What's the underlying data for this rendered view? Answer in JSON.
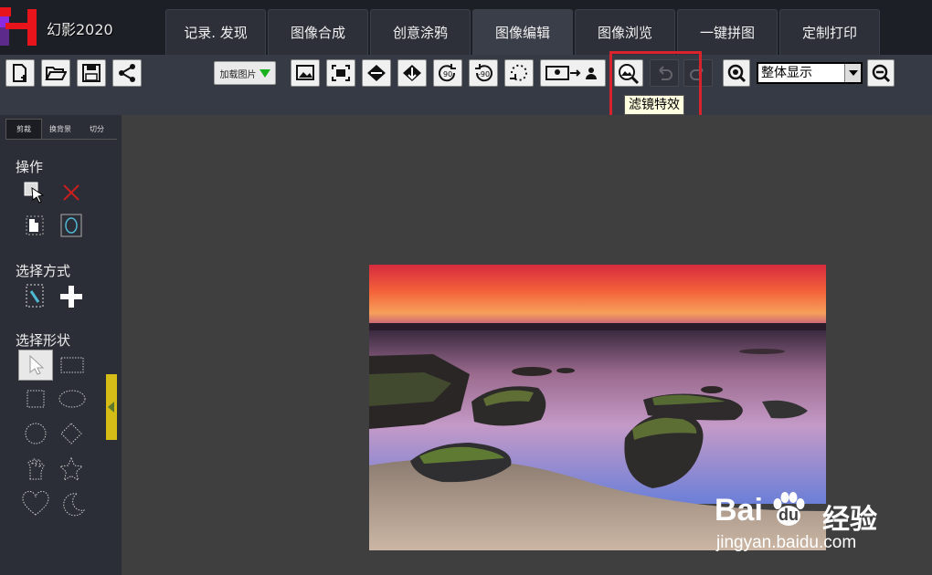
{
  "app": {
    "title": "幻影2020"
  },
  "tabs": [
    {
      "label": "记录. 发现"
    },
    {
      "label": "图像合成"
    },
    {
      "label": "创意涂鸦"
    },
    {
      "label": "图像编辑",
      "active": true
    },
    {
      "label": "图像浏览"
    },
    {
      "label": "一键拼图"
    },
    {
      "label": "定制打印"
    }
  ],
  "toolbar": {
    "load_label": "加载图片",
    "zoom": {
      "value": "整体显示"
    },
    "tooltip": "滤镜特效"
  },
  "left_panel": {
    "sub_tabs": [
      "剪裁",
      "换背景",
      "切分"
    ],
    "sections": {
      "operation": "操作",
      "select_mode": "选择方式",
      "select_shape": "选择形状"
    }
  },
  "watermark": {
    "brand": "Bai",
    "brand2": "du",
    "cn": "经验",
    "url": "jingyan.baidu.com"
  },
  "colors": {
    "accent_red": "#d8222c",
    "toolbar_bg": "#363a44",
    "panel_bg": "#2b2e36",
    "canvas_bg": "#3f3f3f"
  }
}
